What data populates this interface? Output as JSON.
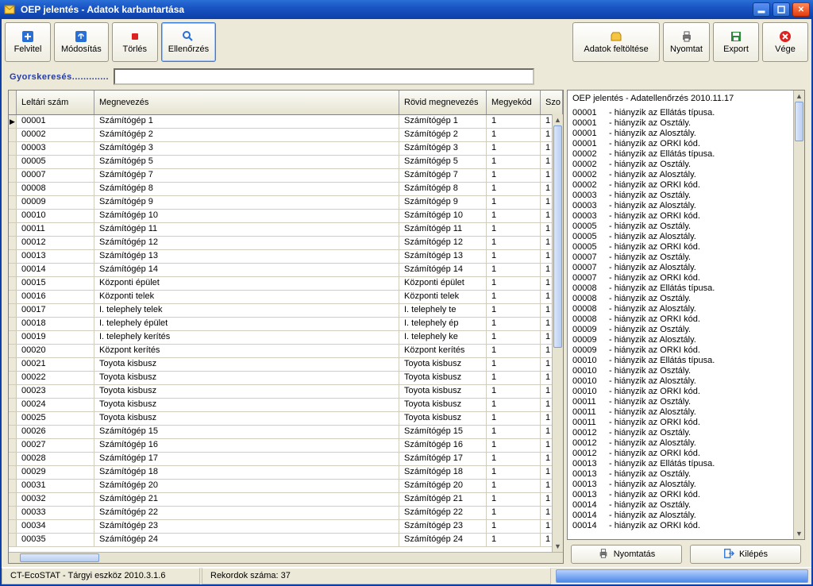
{
  "window": {
    "title": "OEP jelentés - Adatok karbantartása"
  },
  "toolbar": {
    "left": {
      "felvitel": "Felvitel",
      "modositas": "Módosítás",
      "torles": "Törlés",
      "ellenorzes": "Ellenőrzés"
    },
    "right": {
      "adatok_feltoltese": "Adatok feltöltése",
      "nyomtat": "Nyomtat",
      "export": "Export",
      "vege": "Vége"
    }
  },
  "search": {
    "label": "Gyorskeresés.............",
    "value": ""
  },
  "table": {
    "headers": {
      "leltari": "Leltári szám",
      "megnev": "Megnevezés",
      "rovid": "Rövid megnevezés",
      "megyek": "Megyekód",
      "szo": "Szo"
    },
    "rows": [
      {
        "id": "00001",
        "name": "Számítógép 1",
        "short": "Számítógép 1",
        "megyek": "1",
        "szo": "1"
      },
      {
        "id": "00002",
        "name": "Számítógép 2",
        "short": "Számítógép 2",
        "megyek": "1",
        "szo": "1"
      },
      {
        "id": "00003",
        "name": "Számítógép 3",
        "short": "Számítógép 3",
        "megyek": "1",
        "szo": "1"
      },
      {
        "id": "00005",
        "name": "Számítógép 5",
        "short": "Számítógép 5",
        "megyek": "1",
        "szo": "1"
      },
      {
        "id": "00007",
        "name": "Számítógép 7",
        "short": "Számítógép 7",
        "megyek": "1",
        "szo": "1"
      },
      {
        "id": "00008",
        "name": "Számítógép 8",
        "short": "Számítógép 8",
        "megyek": "1",
        "szo": "1"
      },
      {
        "id": "00009",
        "name": "Számítógép 9",
        "short": "Számítógép 9",
        "megyek": "1",
        "szo": "1"
      },
      {
        "id": "00010",
        "name": "Számítógép 10",
        "short": "Számítógép 10",
        "megyek": "1",
        "szo": "1"
      },
      {
        "id": "00011",
        "name": "Számítógép 11",
        "short": "Számítógép 11",
        "megyek": "1",
        "szo": "1"
      },
      {
        "id": "00012",
        "name": "Számítógép 12",
        "short": "Számítógép 12",
        "megyek": "1",
        "szo": "1"
      },
      {
        "id": "00013",
        "name": "Számítógép 13",
        "short": "Számítógép 13",
        "megyek": "1",
        "szo": "1"
      },
      {
        "id": "00014",
        "name": "Számítógép 14",
        "short": "Számítógép 14",
        "megyek": "1",
        "szo": "1"
      },
      {
        "id": "00015",
        "name": "Központi épület",
        "short": "Központi épület",
        "megyek": "1",
        "szo": "1"
      },
      {
        "id": "00016",
        "name": "Központi telek",
        "short": "Központi telek",
        "megyek": "1",
        "szo": "1"
      },
      {
        "id": "00017",
        "name": "I. telephely telek",
        "short": "I. telephely te",
        "megyek": "1",
        "szo": "1"
      },
      {
        "id": "00018",
        "name": "I. telephely épület",
        "short": "I. telephely ép",
        "megyek": "1",
        "szo": "1"
      },
      {
        "id": "00019",
        "name": "I. telephely kerítés",
        "short": "I. telephely ke",
        "megyek": "1",
        "szo": "1"
      },
      {
        "id": "00020",
        "name": "Központ kerítés",
        "short": "Központ kerítés",
        "megyek": "1",
        "szo": "1"
      },
      {
        "id": "00021",
        "name": "Toyota kisbusz",
        "short": "Toyota kisbusz",
        "megyek": "1",
        "szo": "1"
      },
      {
        "id": "00022",
        "name": "Toyota kisbusz",
        "short": "Toyota kisbusz",
        "megyek": "1",
        "szo": "1"
      },
      {
        "id": "00023",
        "name": "Toyota kisbusz",
        "short": "Toyota kisbusz",
        "megyek": "1",
        "szo": "1"
      },
      {
        "id": "00024",
        "name": "Toyota kisbusz",
        "short": "Toyota kisbusz",
        "megyek": "1",
        "szo": "1"
      },
      {
        "id": "00025",
        "name": "Toyota kisbusz",
        "short": "Toyota kisbusz",
        "megyek": "1",
        "szo": "1"
      },
      {
        "id": "00026",
        "name": "Számítógép 15",
        "short": "Számítógép 15",
        "megyek": "1",
        "szo": "1"
      },
      {
        "id": "00027",
        "name": "Számítógép 16",
        "short": "Számítógép 16",
        "megyek": "1",
        "szo": "1"
      },
      {
        "id": "00028",
        "name": "Számítógép 17",
        "short": "Számítógép 17",
        "megyek": "1",
        "szo": "1"
      },
      {
        "id": "00029",
        "name": "Számítógép 18",
        "short": "Számítógép 18",
        "megyek": "1",
        "szo": "1"
      },
      {
        "id": "00031",
        "name": "Számítógép 20",
        "short": "Számítógép 20",
        "megyek": "1",
        "szo": "1"
      },
      {
        "id": "00032",
        "name": "Számítógép 21",
        "short": "Számítógép 21",
        "megyek": "1",
        "szo": "1"
      },
      {
        "id": "00033",
        "name": "Számítógép 22",
        "short": "Számítógép 22",
        "megyek": "1",
        "szo": "1"
      },
      {
        "id": "00034",
        "name": "Számítógép 23",
        "short": "Számítógép 23",
        "megyek": "1",
        "szo": "1"
      },
      {
        "id": "00035",
        "name": "Számítógép 24",
        "short": "Számítógép 24",
        "megyek": "1",
        "szo": "1"
      }
    ]
  },
  "log": {
    "header": "OEP jelentés - Adatellenőrzés 2010.11.17",
    "lines": [
      {
        "id": "00001",
        "msg": "- hiányzik az Ellátás típusa."
      },
      {
        "id": "00001",
        "msg": "- hiányzik az Osztály."
      },
      {
        "id": "00001",
        "msg": "- hiányzik az Alosztály."
      },
      {
        "id": "00001",
        "msg": "- hiányzik az ORKI kód."
      },
      {
        "id": "00002",
        "msg": "- hiányzik az Ellátás típusa."
      },
      {
        "id": "00002",
        "msg": "- hiányzik az Osztály."
      },
      {
        "id": "00002",
        "msg": "- hiányzik az Alosztály."
      },
      {
        "id": "00002",
        "msg": "- hiányzik az ORKI kód."
      },
      {
        "id": "00003",
        "msg": "- hiányzik az Osztály."
      },
      {
        "id": "00003",
        "msg": "- hiányzik az Alosztály."
      },
      {
        "id": "00003",
        "msg": "- hiányzik az ORKI kód."
      },
      {
        "id": "00005",
        "msg": "- hiányzik az Osztály."
      },
      {
        "id": "00005",
        "msg": "- hiányzik az Alosztály."
      },
      {
        "id": "00005",
        "msg": "- hiányzik az ORKI kód."
      },
      {
        "id": "00007",
        "msg": "- hiányzik az Osztály."
      },
      {
        "id": "00007",
        "msg": "- hiányzik az Alosztály."
      },
      {
        "id": "00007",
        "msg": "- hiányzik az ORKI kód."
      },
      {
        "id": "00008",
        "msg": "- hiányzik az Ellátás típusa."
      },
      {
        "id": "00008",
        "msg": "- hiányzik az Osztály."
      },
      {
        "id": "00008",
        "msg": "- hiányzik az Alosztály."
      },
      {
        "id": "00008",
        "msg": "- hiányzik az ORKI kód."
      },
      {
        "id": "00009",
        "msg": "- hiányzik az Osztály."
      },
      {
        "id": "00009",
        "msg": "- hiányzik az Alosztály."
      },
      {
        "id": "00009",
        "msg": "- hiányzik az ORKI kód."
      },
      {
        "id": "00010",
        "msg": "- hiányzik az Ellátás típusa."
      },
      {
        "id": "00010",
        "msg": "- hiányzik az Osztály."
      },
      {
        "id": "00010",
        "msg": "- hiányzik az Alosztály."
      },
      {
        "id": "00010",
        "msg": "- hiányzik az ORKI kód."
      },
      {
        "id": "00011",
        "msg": "- hiányzik az Osztály."
      },
      {
        "id": "00011",
        "msg": "- hiányzik az Alosztály."
      },
      {
        "id": "00011",
        "msg": "- hiányzik az ORKI kód."
      },
      {
        "id": "00012",
        "msg": "- hiányzik az Osztály."
      },
      {
        "id": "00012",
        "msg": "- hiányzik az Alosztály."
      },
      {
        "id": "00012",
        "msg": "- hiányzik az ORKI kód."
      },
      {
        "id": "00013",
        "msg": "- hiányzik az Ellátás típusa."
      },
      {
        "id": "00013",
        "msg": "- hiányzik az Osztály."
      },
      {
        "id": "00013",
        "msg": "- hiányzik az Alosztály."
      },
      {
        "id": "00013",
        "msg": "- hiányzik az ORKI kód."
      },
      {
        "id": "00014",
        "msg": "- hiányzik az Osztály."
      },
      {
        "id": "00014",
        "msg": "- hiányzik az Alosztály."
      },
      {
        "id": "00014",
        "msg": "- hiányzik az ORKI kód."
      }
    ]
  },
  "right_buttons": {
    "print": "Nyomtatás",
    "exit": "Kilépés"
  },
  "status": {
    "app": "CT-EcoSTAT - Tárgyi eszköz 2010.3.1.6",
    "records": "Rekordok száma: 37"
  },
  "colors": {
    "accent": "#0c3fa8",
    "button_bg": "#efede0"
  }
}
